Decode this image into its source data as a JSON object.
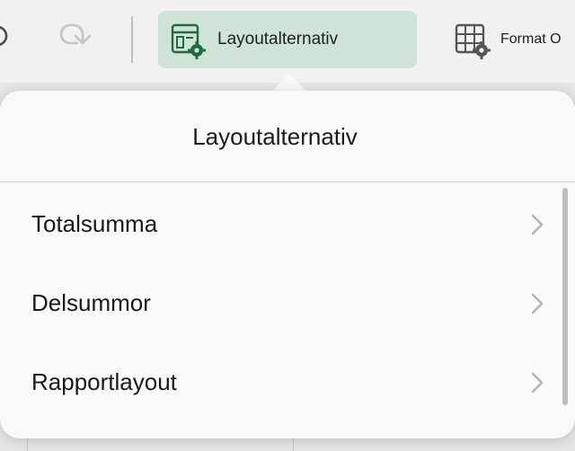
{
  "toolbar": {
    "undo_icon": "undo-icon",
    "redo_icon": "redo-icon",
    "layout_button": {
      "label": "Layoutalternativ",
      "icon": "layout-options-icon"
    },
    "format_button": {
      "label": "Format O",
      "icon": "format-table-icon"
    }
  },
  "popover": {
    "title": "Layoutalternativ",
    "items": [
      {
        "label": "Totalsumma",
        "icon": "chevron-right-icon"
      },
      {
        "label": "Delsummor",
        "icon": "chevron-right-icon"
      },
      {
        "label": "Rapportlayout",
        "icon": "chevron-right-icon"
      }
    ]
  },
  "colors": {
    "accent_bg": "#cfe3d6",
    "accent_icon": "#1e6b40",
    "toolbar_bg": "#f1f1f1",
    "popover_bg": "#f9f9f9"
  }
}
